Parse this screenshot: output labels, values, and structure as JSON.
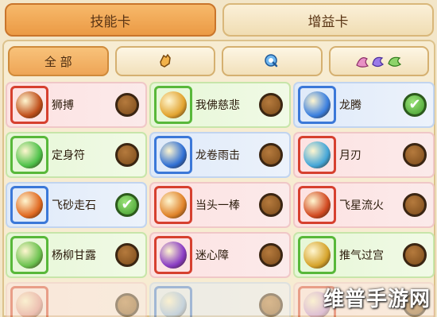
{
  "top_tabs": [
    {
      "label": "技能卡",
      "active": true
    },
    {
      "label": "增益卡",
      "active": false
    }
  ],
  "filters": [
    {
      "label": "全 部",
      "icon": "",
      "active": true
    },
    {
      "label": "",
      "icon": "hand-icon",
      "active": false
    },
    {
      "label": "",
      "icon": "swirl-icon",
      "active": false
    },
    {
      "label": "",
      "icon": "element-icons",
      "active": false
    }
  ],
  "skills": [
    {
      "name": "狮搏",
      "bg": "pink",
      "frame": "red",
      "orb": "#c0501c",
      "checked": false
    },
    {
      "name": "我佛慈悲",
      "bg": "green",
      "frame": "green",
      "orb": "#e2a431",
      "checked": false
    },
    {
      "name": "龙腾",
      "bg": "blue",
      "frame": "blue",
      "orb": "#3a7fe0",
      "checked": true
    },
    {
      "name": "定身符",
      "bg": "green",
      "frame": "green",
      "orb": "#4ec24a",
      "checked": false
    },
    {
      "name": "龙卷雨击",
      "bg": "blue",
      "frame": "blue",
      "orb": "#2f6fd4",
      "checked": false
    },
    {
      "name": "月刃",
      "bg": "pink",
      "frame": "red",
      "orb": "#44a6d8",
      "checked": false
    },
    {
      "name": "飞砂走石",
      "bg": "blue",
      "frame": "blue",
      "orb": "#e06a22",
      "checked": true
    },
    {
      "name": "当头一棒",
      "bg": "pink",
      "frame": "red",
      "orb": "#e0832a",
      "checked": false
    },
    {
      "name": "飞星流火",
      "bg": "pink",
      "frame": "red",
      "orb": "#d24a22",
      "checked": false
    },
    {
      "name": "杨柳甘露",
      "bg": "green",
      "frame": "green",
      "orb": "#6bc24f",
      "checked": false
    },
    {
      "name": "迷心障",
      "bg": "pink",
      "frame": "red",
      "orb": "#8a3cc4",
      "checked": false
    },
    {
      "name": "推气过宫",
      "bg": "green",
      "frame": "green",
      "orb": "#d6a42c",
      "checked": false
    },
    {
      "name": "",
      "bg": "pink",
      "frame": "red",
      "orb": "#e08a8a",
      "checked": false,
      "faded": true
    },
    {
      "name": "",
      "bg": "blue",
      "frame": "blue",
      "orb": "#8ab4e8",
      "checked": false,
      "faded": true
    },
    {
      "name": "",
      "bg": "pink",
      "frame": "red",
      "orb": "#c08ad8",
      "checked": false,
      "faded": true
    }
  ],
  "watermark": "维普手游网"
}
